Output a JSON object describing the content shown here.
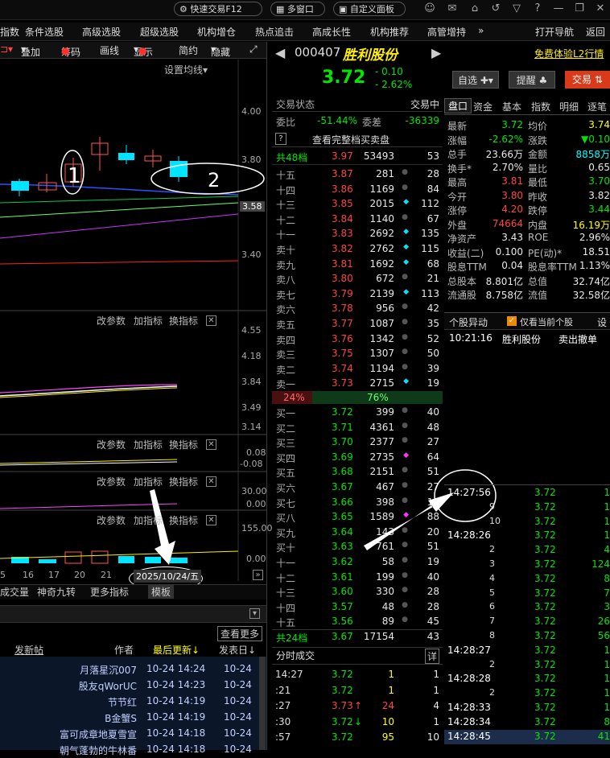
{
  "topbar": {
    "quick_trade": "快速交易F12",
    "multi_window": "多窗口",
    "custom_panel": "自定义面板"
  },
  "menu": [
    "指数",
    "条件选股",
    "高级选股",
    "超级选股",
    "机构增仓",
    "热点追击",
    "高成长性",
    "机构推荐",
    "高管增持",
    "»",
    "打开导航",
    "返回"
  ],
  "left_toolbar": {
    "items": [
      "叠加",
      "筹码",
      "画线",
      "显示",
      "简约",
      "隐藏"
    ],
    "setting_line": "设置均线"
  },
  "chart": {
    "price_axis": [
      "4.00",
      "3.80",
      "3.58",
      "3.40"
    ],
    "panel2_axis": [
      "4.55",
      "4.18",
      "3.84",
      "3.49",
      "3.14"
    ],
    "panel3_axis": [
      "0.08",
      "-0.08"
    ],
    "panel4_axis": [
      "30.00",
      "0.00"
    ],
    "panel5_axis": [
      "155.00",
      "0.00"
    ],
    "panel_btns": [
      "改参数",
      "加指标",
      "换指标"
    ],
    "xticks": [
      "5",
      "16",
      "17",
      "20",
      "21"
    ],
    "date_label": "2025/10/24/五",
    "annot1": "1",
    "annot2": "2"
  },
  "bottom_tabs": [
    "成交量",
    "神奇九转",
    "更多指标",
    "模板"
  ],
  "news": {
    "view_more": "查看更多",
    "headers": {
      "post": "发新帖",
      "author": "作者",
      "last_update": "最后更新↓",
      "post_date": "发表日↓"
    },
    "rows": [
      {
        "author": "月落星沉007",
        "update": "10-24 14:24",
        "date": "10-24"
      },
      {
        "author": "股友qWorUC",
        "update": "10-24 14:23",
        "date": "10-24"
      },
      {
        "author": "节节红",
        "update": "10-24 14:19",
        "date": "10-24"
      },
      {
        "author": "B金蟹S",
        "update": "10-24 14:19",
        "date": "10-24"
      },
      {
        "author": "富可成章地夏雪宣",
        "update": "10-24 14:18",
        "date": "10-24"
      },
      {
        "author": "朝气蓬勃的牛林番",
        "update": "10-24 14:18",
        "date": "10-24"
      }
    ]
  },
  "stock": {
    "code": "000407",
    "name": "胜利股份",
    "price": "3.72",
    "change": "- 0.10",
    "change_pct": "- 2.62%",
    "l2_link": "免费体验L2行情",
    "btn_watch": "自选",
    "btn_alert": "提醒",
    "btn_trade": "交易"
  },
  "orderbook": {
    "status_label": "交易状态",
    "status_value": "交易中",
    "wei_bi_label": "委比",
    "wei_bi": "-51.44%",
    "wei_cha_label": "委差",
    "wei_cha": "-36339",
    "full_queue": "查看完整档买卖盘",
    "sell_total": {
      "label": "共48档",
      "price": "3.97",
      "vol": "53493",
      "n": "53"
    },
    "sells": [
      {
        "l": "十五",
        "p": "3.87",
        "v": "281",
        "n": "28"
      },
      {
        "l": "十四",
        "p": "3.86",
        "v": "1169",
        "n": "84"
      },
      {
        "l": "十三",
        "p": "3.85",
        "v": "2015",
        "n": "112"
      },
      {
        "l": "十二",
        "p": "3.84",
        "v": "1140",
        "n": "67"
      },
      {
        "l": "十一",
        "p": "3.83",
        "v": "2692",
        "n": "135"
      },
      {
        "l": "卖十",
        "p": "3.82",
        "v": "2762",
        "n": "115"
      },
      {
        "l": "卖九",
        "p": "3.81",
        "v": "1692",
        "n": "68"
      },
      {
        "l": "卖八",
        "p": "3.80",
        "v": "672",
        "n": "21"
      },
      {
        "l": "卖七",
        "p": "3.79",
        "v": "2139",
        "n": "113"
      },
      {
        "l": "卖六",
        "p": "3.78",
        "v": "956",
        "n": "42"
      },
      {
        "l": "卖五",
        "p": "3.77",
        "v": "1087",
        "n": "35"
      },
      {
        "l": "卖四",
        "p": "3.76",
        "v": "1342",
        "n": "52"
      },
      {
        "l": "卖三",
        "p": "3.75",
        "v": "1307",
        "n": "50"
      },
      {
        "l": "卖二",
        "p": "3.74",
        "v": "1194",
        "n": "39"
      },
      {
        "l": "卖一",
        "p": "3.73",
        "v": "2715",
        "n": "19"
      }
    ],
    "ratio_sell": "24%",
    "ratio_buy": "76%",
    "buys": [
      {
        "l": "买一",
        "p": "3.72",
        "v": "399",
        "n": "40"
      },
      {
        "l": "买二",
        "p": "3.71",
        "v": "4361",
        "n": "48"
      },
      {
        "l": "买三",
        "p": "3.70",
        "v": "2377",
        "n": "27"
      },
      {
        "l": "买四",
        "p": "3.69",
        "v": "2735",
        "n": "64"
      },
      {
        "l": "买五",
        "p": "3.68",
        "v": "2151",
        "n": "51"
      },
      {
        "l": "买六",
        "p": "3.67",
        "v": "467",
        "n": "27"
      },
      {
        "l": "买七",
        "p": "3.66",
        "v": "398",
        "n": "15"
      },
      {
        "l": "买八",
        "p": "3.65",
        "v": "1589",
        "n": "88"
      },
      {
        "l": "买九",
        "p": "3.64",
        "v": "143",
        "n": "20"
      },
      {
        "l": "买十",
        "p": "3.63",
        "v": "761",
        "n": "51"
      },
      {
        "l": "十一",
        "p": "3.62",
        "v": "58",
        "n": "19"
      },
      {
        "l": "十二",
        "p": "3.61",
        "v": "199",
        "n": "40"
      },
      {
        "l": "十三",
        "p": "3.60",
        "v": "330",
        "n": "28"
      },
      {
        "l": "十四",
        "p": "3.57",
        "v": "48",
        "n": "28"
      },
      {
        "l": "十五",
        "p": "3.56",
        "v": "89",
        "n": "45"
      }
    ],
    "buy_total": {
      "label": "共24档",
      "price": "3.67",
      "vol": "17154",
      "n": "43"
    }
  },
  "fenshi": {
    "title": "分时成交",
    "detail": "详",
    "rows": [
      {
        "t": "14:27",
        "p": "3.72",
        "v": "1",
        "n": "1",
        "arrow": ""
      },
      {
        "t": ":21",
        "p": "3.72",
        "v": "1",
        "n": "1",
        "arrow": ""
      },
      {
        "t": ":27",
        "p": "3.73",
        "v": "24",
        "n": "4",
        "arrow": "↑"
      },
      {
        "t": ":30",
        "p": "3.72",
        "v": "10",
        "n": "1",
        "arrow": "↓"
      },
      {
        "t": ":57",
        "p": "3.72",
        "v": "95",
        "n": "10",
        "arrow": ""
      }
    ]
  },
  "quote_tabs": [
    "盘口",
    "资金",
    "基本",
    "指数",
    "明细",
    "逐笔"
  ],
  "quote": [
    {
      "a": "最新",
      "av": "3.72",
      "b": "均价",
      "bv": "3.74"
    },
    {
      "a": "涨幅",
      "av": "-2.62%",
      "b": "涨跌",
      "bv": "▼0.10"
    },
    {
      "a": "总手",
      "av": "23.66万",
      "b": "金额",
      "bv": "8858万"
    },
    {
      "a": "换手*",
      "av": "2.70%",
      "b": "量比",
      "bv": "0.65"
    },
    {
      "a": "最高",
      "av": "3.81",
      "b": "最低",
      "bv": "3.70"
    },
    {
      "a": "今开",
      "av": "3.80",
      "b": "昨收",
      "bv": "3.82"
    },
    {
      "a": "涨停",
      "av": "4.20",
      "b": "跌停",
      "bv": "3.44"
    },
    {
      "a": "外盘",
      "av": "74664",
      "b": "内盘",
      "bv": "16.19万"
    },
    {
      "a": "净资产",
      "av": "3.43",
      "b": "ROE",
      "bv": "2.96%"
    },
    {
      "a": "收益(二)",
      "av": "0.100",
      "b": "PE(动)*",
      "bv": "18.51"
    },
    {
      "a": "股息TTM",
      "av": "0.04",
      "b": "股息率TTM",
      "bv": "1.13%"
    },
    {
      "a": "总股本",
      "av": "8.801亿",
      "b": "总值",
      "bv": "32.74亿"
    },
    {
      "a": "流通股",
      "av": "8.758亿",
      "b": "流值",
      "bv": "32.58亿"
    }
  ],
  "anomaly": {
    "title": "个股异动",
    "only_current": "仅看当前个股",
    "setting": "设",
    "row": {
      "t": "10:21:16",
      "name": "胜利股份",
      "event": "卖出撤单"
    }
  },
  "ticks": [
    {
      "t": "14:27:56",
      "p": "3.72",
      "v": "1"
    },
    {
      "t": "9",
      "p": "3.72",
      "v": "1"
    },
    {
      "t": "10",
      "p": "3.72",
      "v": "1"
    },
    {
      "t": "14:28:26",
      "p": "3.72",
      "v": "1"
    },
    {
      "t": "2",
      "p": "3.72",
      "v": "4"
    },
    {
      "t": "3",
      "p": "3.72",
      "v": "124"
    },
    {
      "t": "4",
      "p": "3.72",
      "v": "8"
    },
    {
      "t": "5",
      "p": "3.72",
      "v": "7"
    },
    {
      "t": "6",
      "p": "3.72",
      "v": "3"
    },
    {
      "t": "7",
      "p": "3.72",
      "v": "26"
    },
    {
      "t": "8",
      "p": "3.72",
      "v": "56"
    },
    {
      "t": "14:28:27",
      "p": "3.72",
      "v": "1"
    },
    {
      "t": "2",
      "p": "3.72",
      "v": "1"
    },
    {
      "t": "14:28:28",
      "p": "3.72",
      "v": "1"
    },
    {
      "t": "2",
      "p": "3.72",
      "v": "1"
    },
    {
      "t": "14:28:33",
      "p": "3.72",
      "v": "1"
    },
    {
      "t": "14:28:34",
      "p": "3.72",
      "v": "8"
    },
    {
      "t": "14:28:45",
      "p": "3.72",
      "v": "41"
    }
  ],
  "colors": {
    "up": "#ff4444",
    "down": "#00e600",
    "accent": "#ffff00"
  }
}
